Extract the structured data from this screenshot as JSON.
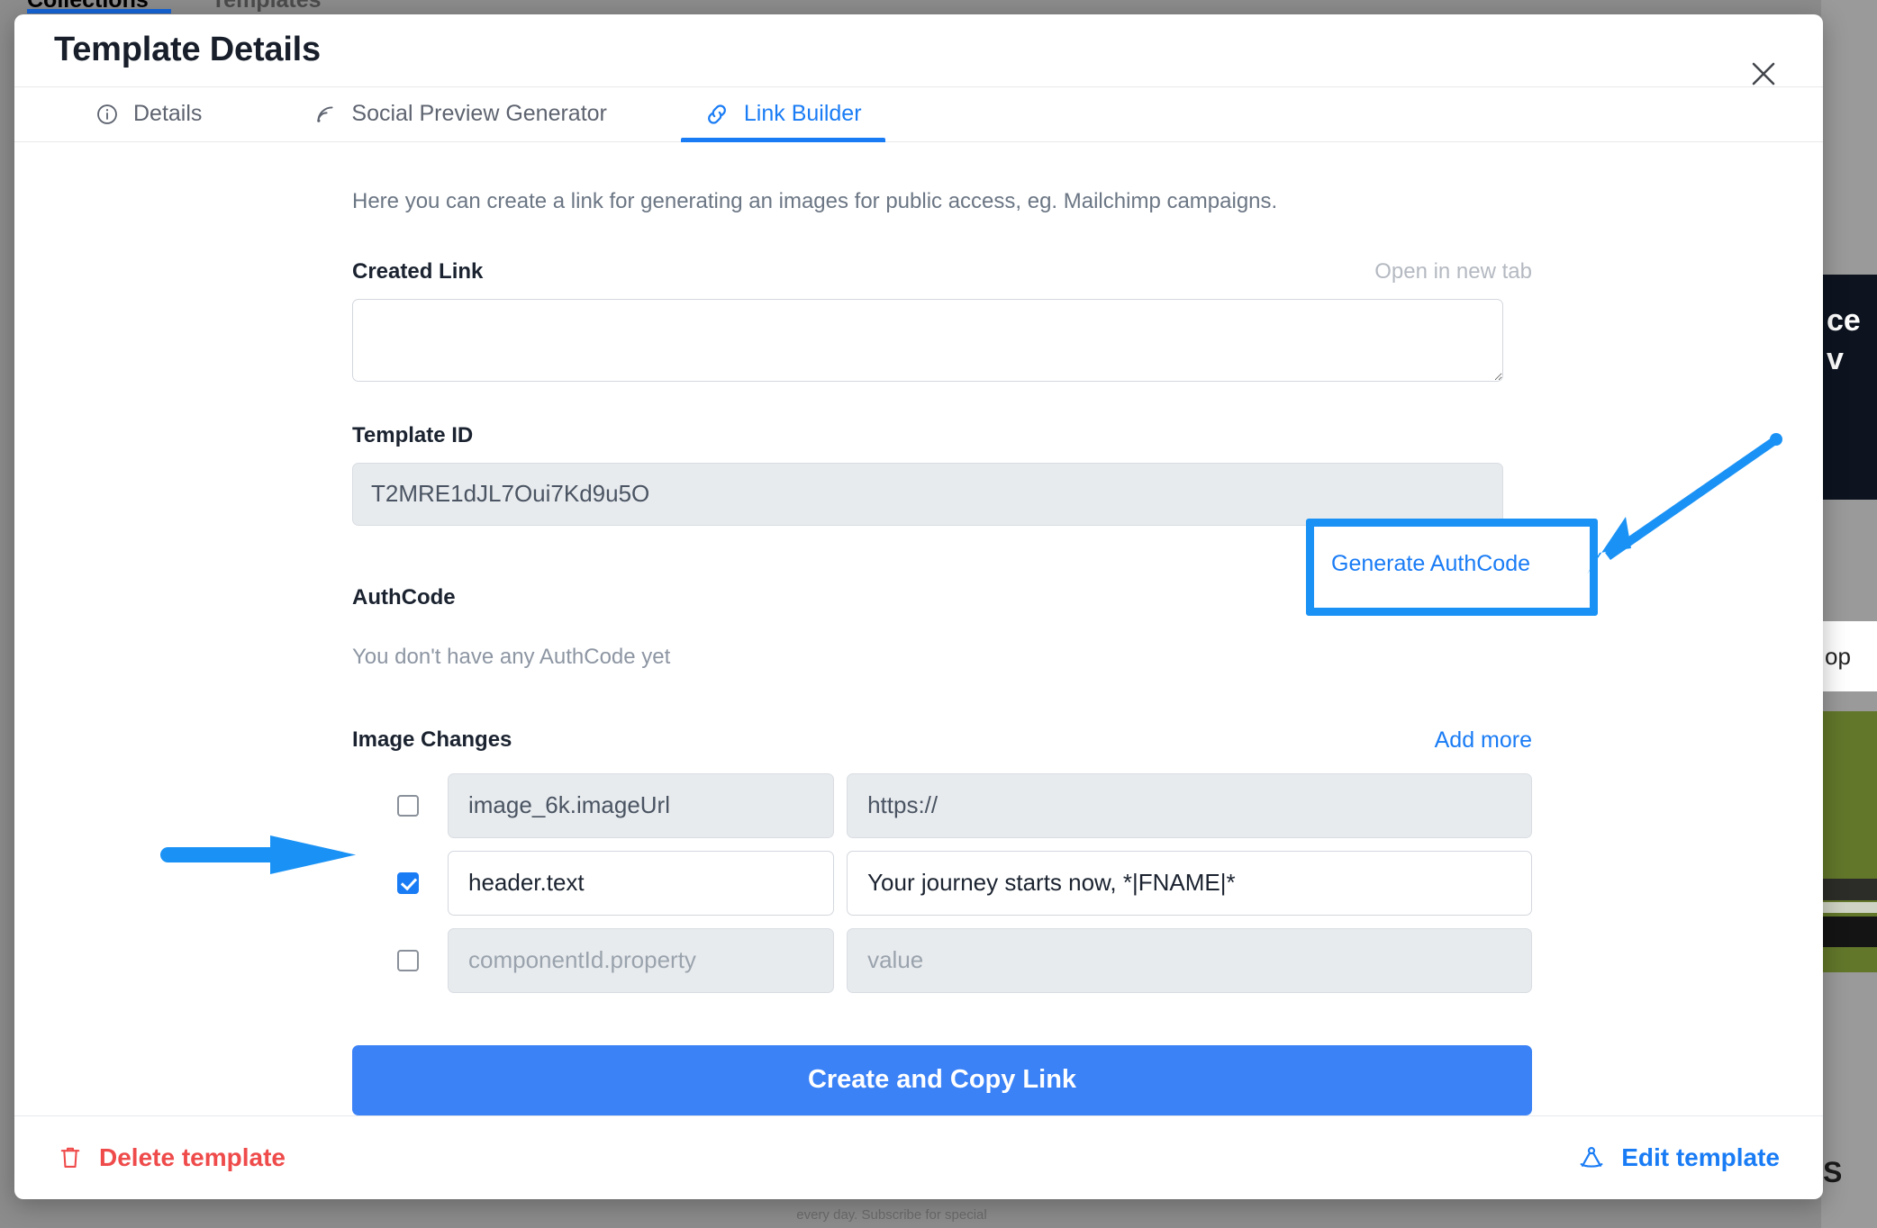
{
  "background": {
    "tabs": [
      {
        "label": "Collections"
      },
      {
        "label": "Templates"
      }
    ],
    "side_dark_text": "ce v",
    "side_white_text": "op",
    "side_bottom_text": "S",
    "footer_note": "every day. Subscribe for special"
  },
  "modal": {
    "title": "Template Details",
    "close_icon": "close-icon",
    "tabs": [
      {
        "label": "Details",
        "icon": "info-circle-icon",
        "active": false
      },
      {
        "label": "Social Preview Generator",
        "icon": "rss-feed-icon",
        "active": false
      },
      {
        "label": "Link Builder",
        "icon": "link-chain-icon",
        "active": true
      }
    ],
    "intro": "Here you can create a link for generating an images for public access, eg. Mailchimp campaigns.",
    "created_link": {
      "label": "Created Link",
      "open_in_new_tab": "Open in new tab",
      "value": "",
      "placeholder": ""
    },
    "template_id": {
      "label": "Template ID",
      "value": "T2MRE1dJL7Oui7Kd9u5O"
    },
    "authcode": {
      "label": "AuthCode",
      "empty_message": "You don't have any AuthCode yet",
      "generate_button": "Generate AuthCode"
    },
    "image_changes": {
      "label": "Image Changes",
      "add_more": "Add more",
      "rows": [
        {
          "checked": false,
          "disabled": true,
          "key": "image_6k.imageUrl",
          "key_is_placeholder": false,
          "value": "https://",
          "value_is_placeholder": false
        },
        {
          "checked": true,
          "disabled": false,
          "key": "header.text",
          "key_is_placeholder": false,
          "value": "Your journey starts now, *|FNAME|*",
          "value_is_placeholder": false
        },
        {
          "checked": false,
          "disabled": true,
          "key": "componentId.property",
          "key_is_placeholder": true,
          "value": "value",
          "value_is_placeholder": true
        }
      ]
    },
    "submit_button": "Create and Copy Link",
    "footer": {
      "delete_label": "Delete template",
      "delete_icon": "trash-icon",
      "edit_label": "Edit template",
      "edit_icon": "compass-draft-icon"
    }
  },
  "annotations": {
    "arrow_to_generate_authcode": "arrow-pointing-down-left",
    "arrow_to_row_checkbox": "arrow-pointing-right",
    "highlight_box_target": "Generate AuthCode",
    "color": "#1a92f5"
  },
  "colors": {
    "accent": "#1a7cf5",
    "primary_button": "#3b82f6",
    "danger": "#ef4b4b",
    "annotation": "#1a92f5",
    "disabled_field": "#e8ebee"
  }
}
